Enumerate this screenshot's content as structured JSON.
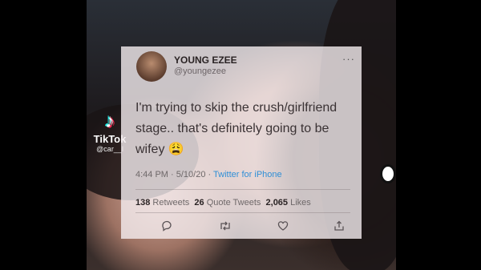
{
  "overlay": {
    "brand": "TikTok",
    "username": "@car__l",
    "logo_icon": "tiktok-note-icon"
  },
  "tweet": {
    "display_name": "YOUNG EZEE",
    "handle": "@youngezee",
    "more_icon": "more-dots-icon",
    "text": "I'm trying to skip the crush/girlfriend stage.. that's definitely going to be wifey 😩",
    "timestamp": "4:44 PM · 5/10/20 · ",
    "source": "Twitter for iPhone",
    "stats": {
      "retweets_count": "138",
      "retweets_label": "Retweets",
      "quotes_count": "26",
      "quotes_label": "Quote Tweets",
      "likes_count": "2,065",
      "likes_label": "Likes"
    },
    "actions": [
      {
        "name": "reply-icon",
        "glyph": "🗨"
      },
      {
        "name": "retweet-icon",
        "glyph": "⟲"
      },
      {
        "name": "like-icon",
        "glyph": "♡"
      },
      {
        "name": "share-icon",
        "glyph": "⇪"
      }
    ]
  }
}
